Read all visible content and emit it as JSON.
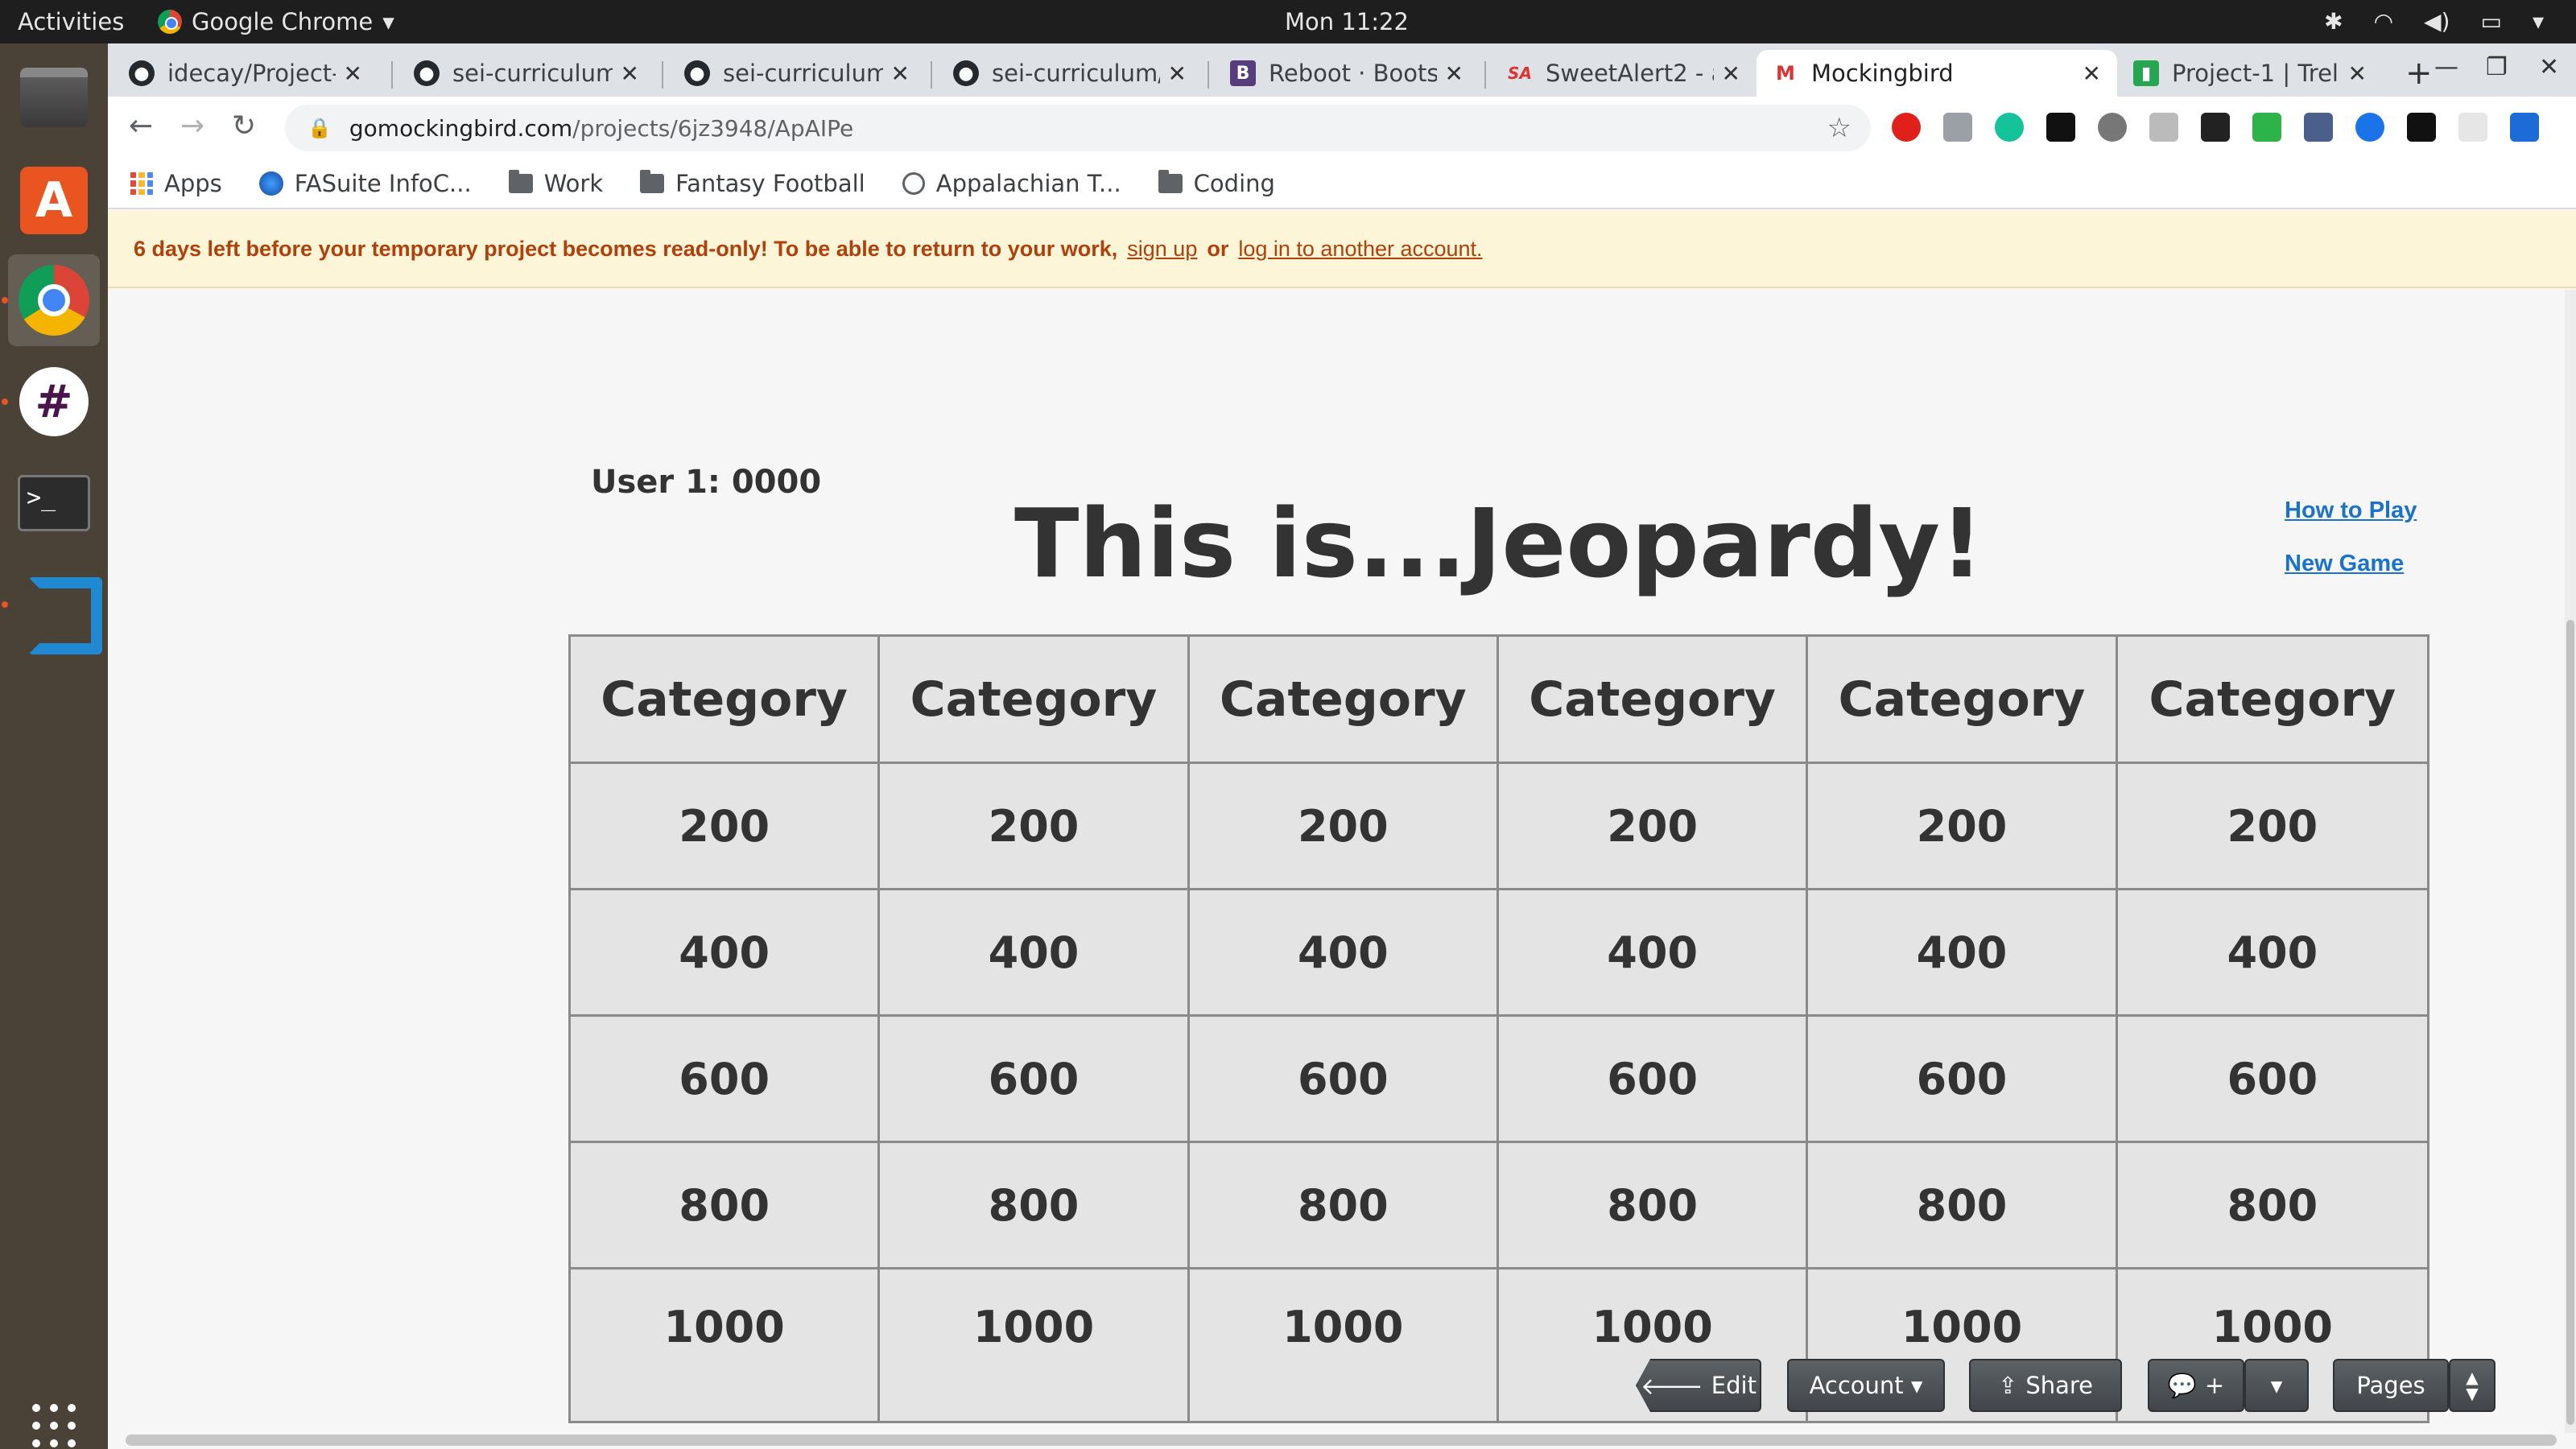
{
  "os": {
    "activities": "Activities",
    "app_name": "Google Chrome",
    "clock": "Mon 11:22"
  },
  "browser": {
    "tabs": [
      {
        "title": "idecay/Project-",
        "icon": "github-icon"
      },
      {
        "title": "sei-curriculum/",
        "icon": "github-icon"
      },
      {
        "title": "sei-curriculum/",
        "icon": "github-icon"
      },
      {
        "title": "sei-curriculum/",
        "icon": "github-icon"
      },
      {
        "title": "Reboot · Boots",
        "icon": "bootstrap-icon"
      },
      {
        "title": "SweetAlert2 - a",
        "icon": "sweetalert-icon"
      },
      {
        "title": "Mockingbird",
        "icon": "mockingbird-icon",
        "active": true
      },
      {
        "title": "Project-1 | Trell",
        "icon": "trello-icon"
      }
    ],
    "url_domain": "gomockingbird.com",
    "url_path": "/projects/6jz3948/ApAIPe",
    "bookmarks": [
      {
        "label": "Apps",
        "icon": "apps-grid-icon"
      },
      {
        "label": "FASuite InfoC...",
        "icon": "fasuite-icon"
      },
      {
        "label": "Work",
        "icon": "folder-icon"
      },
      {
        "label": "Fantasy Football",
        "icon": "folder-icon"
      },
      {
        "label": "Appalachian T...",
        "icon": "globe-icon"
      },
      {
        "label": "Coding",
        "icon": "folder-icon"
      }
    ]
  },
  "banner": {
    "message": "6 days left before your temporary project becomes read-only! To be able to return to your work,",
    "signup": "sign up",
    "or": "or",
    "login": "log in to another account."
  },
  "game": {
    "user_score": "User 1: 0000",
    "title": "This is...Jeopardy!",
    "how_to_play": "How to Play",
    "new_game": "New Game",
    "categories": [
      "Category",
      "Category",
      "Category",
      "Category",
      "Category",
      "Category"
    ],
    "values": [
      "200",
      "400",
      "600",
      "800",
      "1000"
    ]
  },
  "mockingbird_toolbar": {
    "edit": "Edit",
    "account": "Account ▾",
    "share": "Share",
    "comment": "+",
    "dropdown": "▾",
    "pages": "Pages"
  }
}
